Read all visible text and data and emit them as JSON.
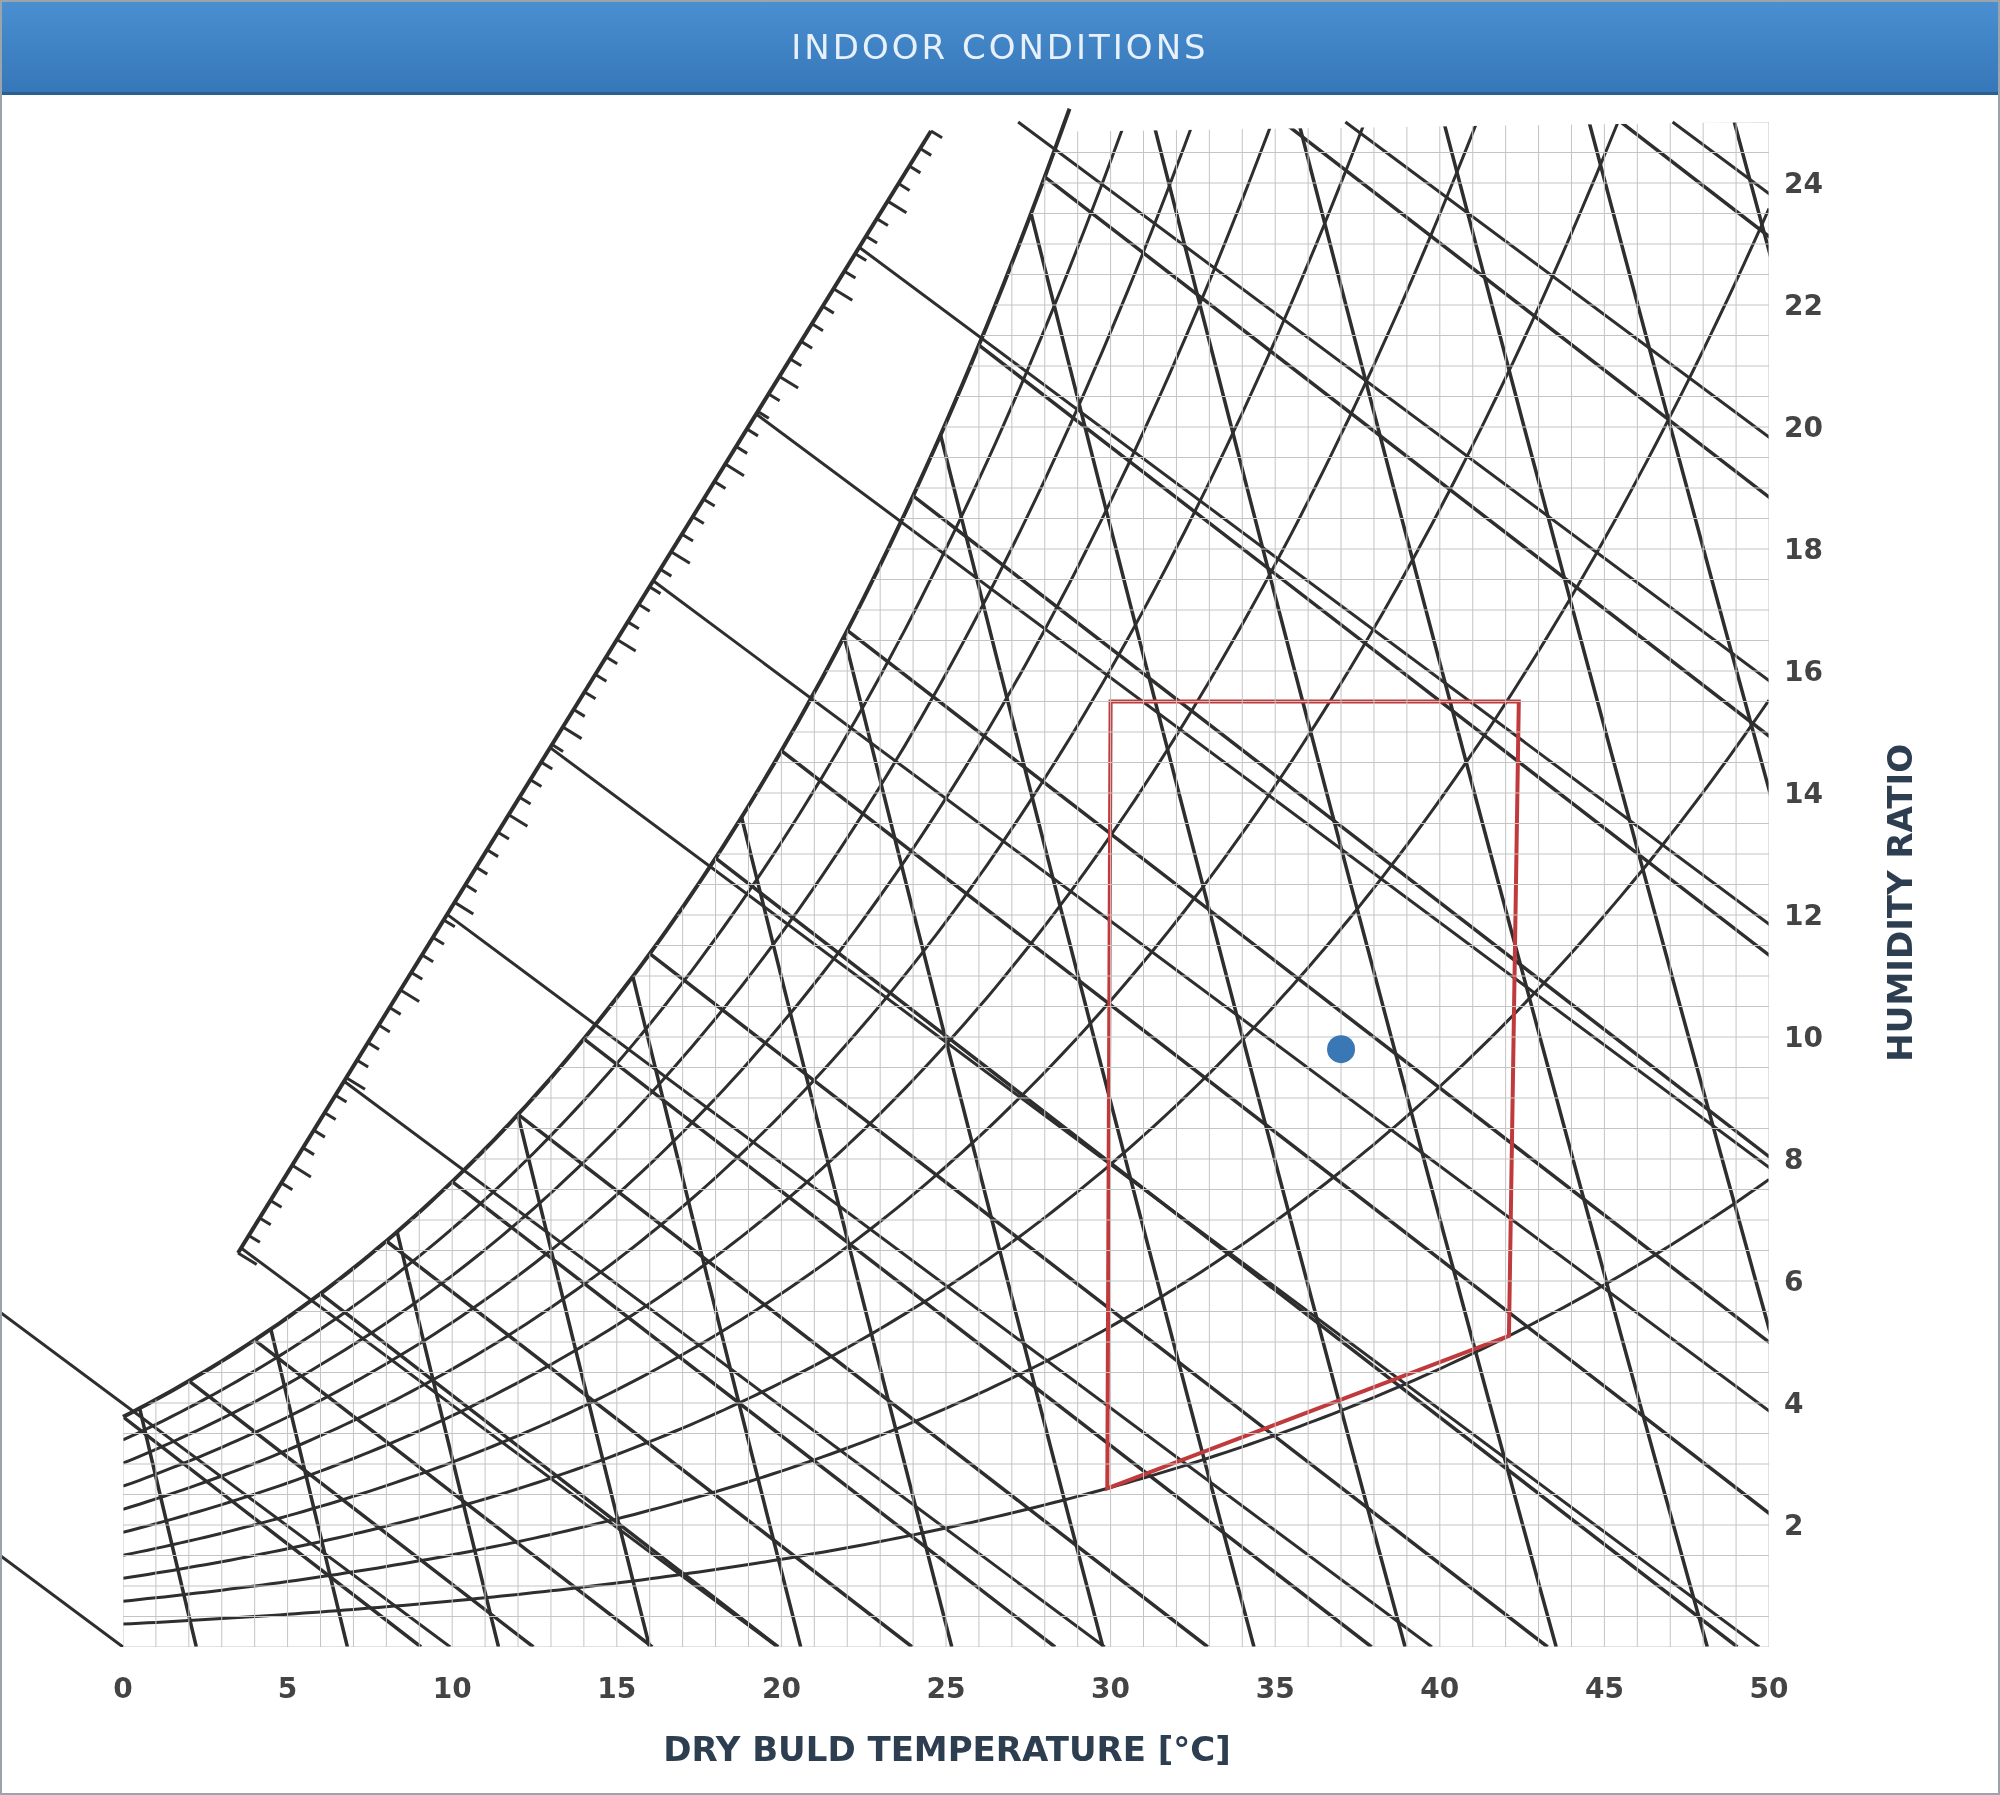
{
  "header": {
    "title": "INDOOR CONDITIONS"
  },
  "chart": {
    "chart_data": {
      "type": "scatter",
      "xlabel": "DRY BULD TEMPERATURE [°C]",
      "ylabel": "HUMIDITY RATIO",
      "xlim": [
        0,
        50
      ],
      "ylim": [
        0,
        25
      ],
      "xticks": [
        0,
        5,
        10,
        15,
        20,
        25,
        30,
        35,
        40,
        45,
        50
      ],
      "yticks": [
        2,
        4,
        6,
        8,
        10,
        12,
        14,
        16,
        18,
        20,
        22,
        24
      ],
      "x": [
        37
      ],
      "series": [
        {
          "color": "#3a78b5",
          "values": [
            9.8
          ]
        }
      ],
      "grid": true
    }
  }
}
